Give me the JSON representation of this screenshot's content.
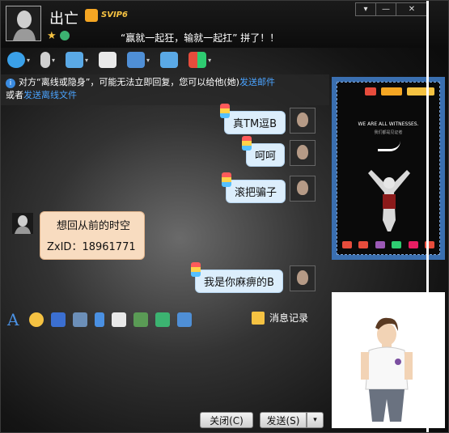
{
  "window": {
    "nickname": "出亡",
    "vip_badge": "SVIP6",
    "signature": "“赢就一起狂，输就一起扛” 拼了！！",
    "controls": {
      "menu": "▾",
      "minimize": "—",
      "close": "✕"
    }
  },
  "toolbar": {
    "items": [
      {
        "icon": "video-call-icon",
        "color": "#3aa0e8"
      },
      {
        "icon": "voice-call-icon",
        "color": "#d0d0d0"
      },
      {
        "icon": "file-transfer-icon",
        "color": "#5aa9e6"
      },
      {
        "icon": "create-discussion-icon",
        "color": "#e9e9e9"
      },
      {
        "icon": "remote-desktop-icon",
        "color": "#4f8fd6"
      },
      {
        "icon": "share-screen-icon",
        "color": "#5aa9e6"
      },
      {
        "icon": "apps-icon",
        "color": "#f0a030"
      }
    ],
    "dropdown": "▾"
  },
  "notice": {
    "icon": "i",
    "text1": "对方“离线或隐身”，可能无法立即回复，您可以给他(她)",
    "link1": "发送邮件",
    "text2": "或者",
    "link2": "发送离线文件"
  },
  "messages": {
    "out": [
      {
        "text": "真TM逗B"
      },
      {
        "text": "呵呵"
      },
      {
        "text": "滚把骗子"
      },
      {
        "text": "我是你麻痹的B"
      }
    ],
    "in": {
      "line1": "想回从前的时空",
      "line2": "ZxID：18961771"
    }
  },
  "format_toolbar": {
    "font_glyph": "A",
    "history_label": "消息记录"
  },
  "buttons": {
    "close": "关闭(C)",
    "send": "发送(S)",
    "send_dropdown": "▾"
  },
  "ad": {
    "title": "WE ARE ALL WITNESSES.",
    "subtitle": "我们都是见证者",
    "bg_color": "#3a6fb0"
  }
}
